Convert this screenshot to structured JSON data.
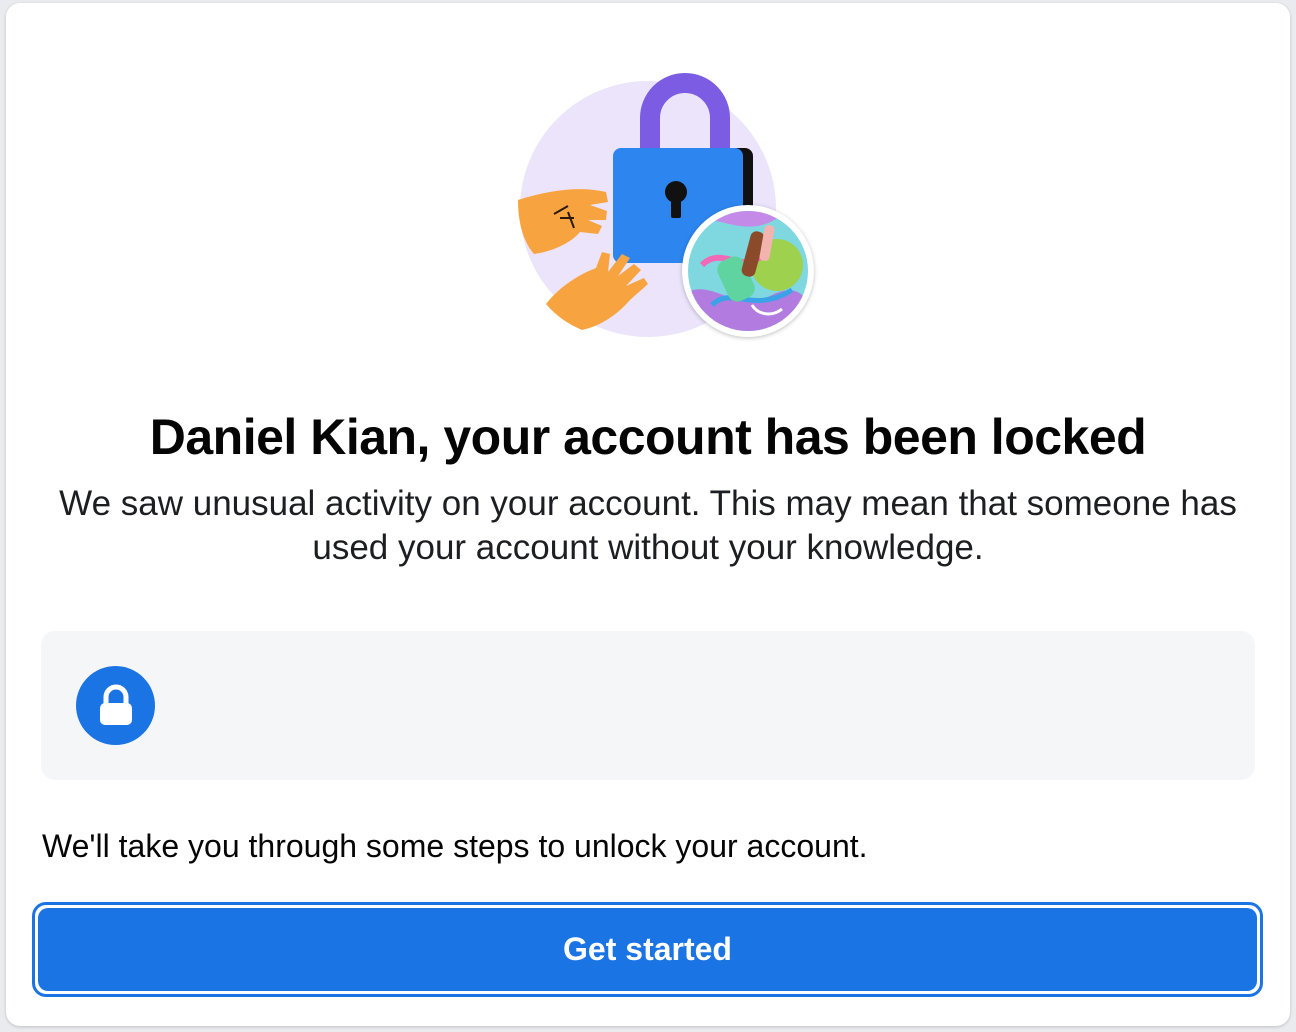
{
  "header": {
    "title": "Daniel Kian, your account has been locked",
    "subtitle": "We saw unusual activity on your account. This may mean that someone has used your account without your knowledge."
  },
  "hero": {
    "illustration_icon": "padlock-with-hands-illustration",
    "avatar_icon": "profile-avatar"
  },
  "info_box": {
    "icon": "lock-icon"
  },
  "body": {
    "steps_text": "We'll take you through some steps to unlock your account."
  },
  "actions": {
    "primary_label": "Get started"
  },
  "colors": {
    "accent": "#1b74e4",
    "lock_shackle": "#7b5ce3",
    "hand": "#f7a440",
    "illustration_bg": "#ebe4fb",
    "info_bg": "#f5f6f7"
  }
}
